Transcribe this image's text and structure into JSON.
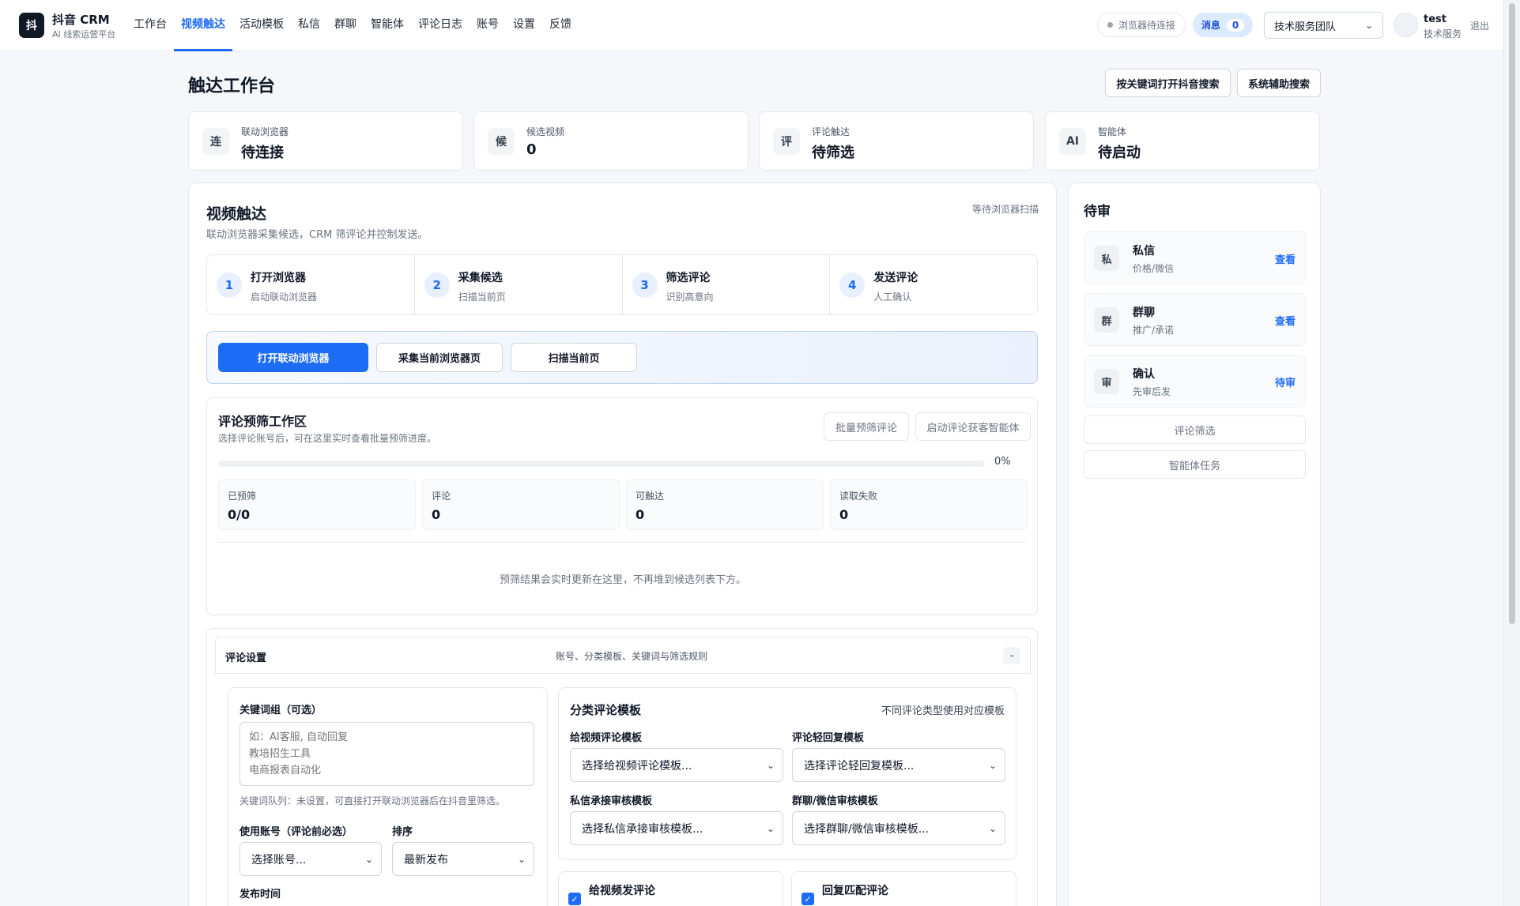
{
  "app": {
    "logo_char": "抖",
    "name": "抖音 CRM",
    "subtitle": "AI 线索运营平台"
  },
  "nav": {
    "items": [
      "工作台",
      "视频触达",
      "活动模板",
      "私信",
      "群聊",
      "智能体",
      "评论日志",
      "账号",
      "设置",
      "反馈"
    ],
    "active_index": 1
  },
  "header": {
    "browser_status": "浏览器待连接",
    "messages_label": "消息",
    "messages_count": "0",
    "team_select": "技术服务团队",
    "user_name": "test",
    "user_team": "技术服务",
    "logout": "退出"
  },
  "page": {
    "title": "触达工作台",
    "btn_keyword_search": "按关键词打开抖音搜索",
    "btn_system_search": "系统辅助搜索"
  },
  "stats": [
    {
      "icon": "连",
      "label": "联动浏览器",
      "value": "待连接"
    },
    {
      "icon": "候",
      "label": "候选视频",
      "value": "0"
    },
    {
      "icon": "评",
      "label": "评论触达",
      "value": "待筛选"
    },
    {
      "icon": "AI",
      "label": "智能体",
      "value": "待启动"
    }
  ],
  "video": {
    "title": "视频触达",
    "subtitle": "联动浏览器采集候选，CRM 筛评论并控制发送。",
    "status": "等待浏览器扫描",
    "steps": [
      {
        "num": "1",
        "title": "打开浏览器",
        "sub": "启动联动浏览器"
      },
      {
        "num": "2",
        "title": "采集候选",
        "sub": "扫描当前页"
      },
      {
        "num": "3",
        "title": "筛选评论",
        "sub": "识别高意向"
      },
      {
        "num": "4",
        "title": "发送评论",
        "sub": "人工确认"
      }
    ],
    "btn_open_browser": "打开联动浏览器",
    "btn_collect": "采集当前浏览器页",
    "btn_scan": "扫描当前页"
  },
  "workspace": {
    "title": "评论预筛工作区",
    "subtitle": "选择评论账号后，可在这里实时查看批量预筛进度。",
    "btn_batch": "批量预筛评论",
    "btn_agent": "启动评论获客智能体",
    "progress_label": "0%",
    "progress": 0,
    "metrics": [
      {
        "label": "已预筛",
        "value": "0/0"
      },
      {
        "label": "评论",
        "value": "0"
      },
      {
        "label": "可触达",
        "value": "0"
      },
      {
        "label": "读取失败",
        "value": "0"
      }
    ],
    "empty": "预筛结果会实时更新在这里，不再堆到候选列表下方。"
  },
  "settings": {
    "title": "评论设置",
    "desc": "账号、分类模板、关键词与筛选规则",
    "collapse": "-",
    "keyword_label": "关键词组（可选）",
    "keyword_placeholder": "如：AI客服, 自动回复\n教培招生工具\n电商报表自动化",
    "keyword_queue": "关键词队列：未设置，可直接打开联动浏览器后在抖音里筛选。",
    "account_label": "使用账号（评论前必选）",
    "account_value": "选择账号...",
    "sort_label": "排序",
    "sort_value": "最新发布",
    "publish_label": "发布时间",
    "tpl_title": "分类评论模板",
    "tpl_hint": "不同评论类型使用对应模板",
    "tpl_video_label": "给视频评论模板",
    "tpl_video_value": "选择给视频评论模板...",
    "tpl_reply_label": "评论轻回复模板",
    "tpl_reply_value": "选择评论轻回复模板...",
    "tpl_dm_label": "私信承接审核模板",
    "tpl_dm_value": "选择私信承接审核模板...",
    "tpl_group_label": "群聊/微信审核模板",
    "tpl_group_value": "选择群聊/微信审核模板...",
    "chk_video": "给视频发评论",
    "chk_reply": "回复匹配评论"
  },
  "review": {
    "title": "待审",
    "items": [
      {
        "icon": "私",
        "title": "私信",
        "sub": "价格/微信",
        "link": "查看"
      },
      {
        "icon": "群",
        "title": "群聊",
        "sub": "推广/承诺",
        "link": "查看"
      },
      {
        "icon": "审",
        "title": "确认",
        "sub": "先审后发",
        "link": "待审"
      }
    ],
    "btn_filter": "评论筛选",
    "btn_agent_task": "智能体任务"
  },
  "colors": {
    "accent": "#1d6cf5",
    "background": "#f5f7fb"
  }
}
